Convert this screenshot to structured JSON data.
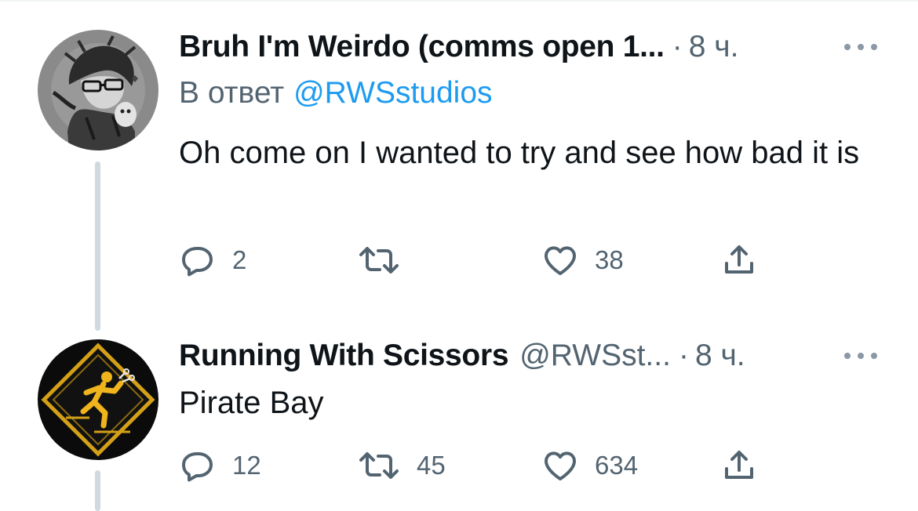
{
  "tweets": [
    {
      "name": "Bruh I'm Weirdo (comms open 1...",
      "handle": "",
      "dot": "·",
      "time": "8 ч.",
      "reply_prefix": "В ответ",
      "reply_mention": "@RWSstudios",
      "text": "Oh come on I wanted to try and see how bad it is",
      "replies": "2",
      "retweets": "",
      "likes": "38",
      "avatar_icon": "sketch-character-avatar"
    },
    {
      "name": "Running With Scissors",
      "handle": "@RWSst...",
      "dot": "·",
      "time": "8 ч.",
      "text": "Pirate Bay",
      "replies": "12",
      "retweets": "45",
      "likes": "634",
      "avatar_icon": "running-man-warning-sign-avatar"
    }
  ],
  "icons": {
    "reply": "speech-bubble-icon",
    "retweet": "retweet-arrows-icon",
    "like": "heart-icon",
    "share": "share-upload-icon",
    "more": "more-dots-icon"
  },
  "colors": {
    "text": "#0f1419",
    "secondary": "#536471",
    "link": "#1d9bf0",
    "thread_line": "#cfd9de"
  }
}
